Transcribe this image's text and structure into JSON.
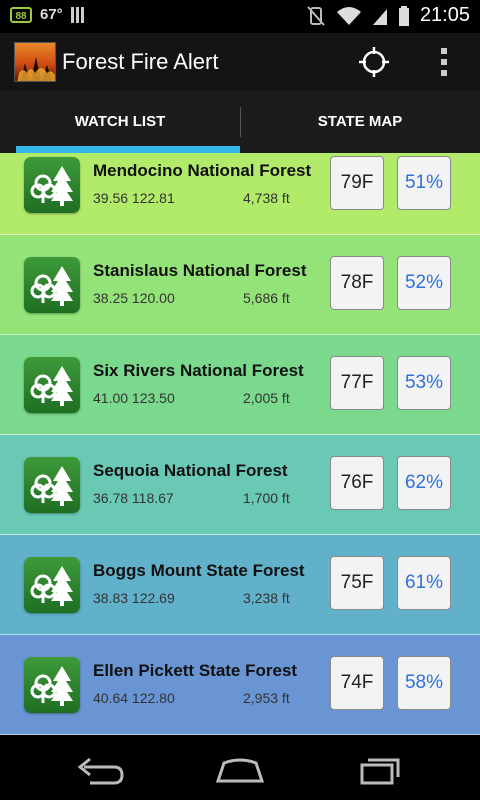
{
  "status_bar": {
    "battery_badge": "88",
    "temperature": "67°",
    "time": "21:05"
  },
  "app": {
    "title": "Forest Fire Alert"
  },
  "tabs": [
    {
      "label": "WATCH LIST",
      "selected": true
    },
    {
      "label": "STATE MAP",
      "selected": false
    }
  ],
  "forests": [
    {
      "name": "Mendocino National Forest",
      "coords": "39.56  122.81",
      "elevation": "4,738 ft",
      "temp": "79F",
      "humidity": "51%",
      "color": "#b2eb69"
    },
    {
      "name": "Stanislaus National Forest",
      "coords": "38.25  120.00",
      "elevation": "5,686 ft",
      "temp": "78F",
      "humidity": "52%",
      "color": "#94e378"
    },
    {
      "name": "Six Rivers National Forest",
      "coords": "41.00  123.50",
      "elevation": "2,005 ft",
      "temp": "77F",
      "humidity": "53%",
      "color": "#7ad98c"
    },
    {
      "name": "Sequoia National Forest",
      "coords": "36.78 118.67",
      "elevation": "1,700 ft",
      "temp": "76F",
      "humidity": "62%",
      "color": "#6ac9b4"
    },
    {
      "name": "Boggs Mount State Forest",
      "coords": "38.83 122.69",
      "elevation": "3,238 ft",
      "temp": "75F",
      "humidity": "61%",
      "color": "#62b1cb"
    },
    {
      "name": "Ellen Pickett State Forest",
      "coords": "40.64  122.80",
      "elevation": "2,953 ft",
      "temp": "74F",
      "humidity": "58%",
      "color": "#6a95d5"
    }
  ]
}
